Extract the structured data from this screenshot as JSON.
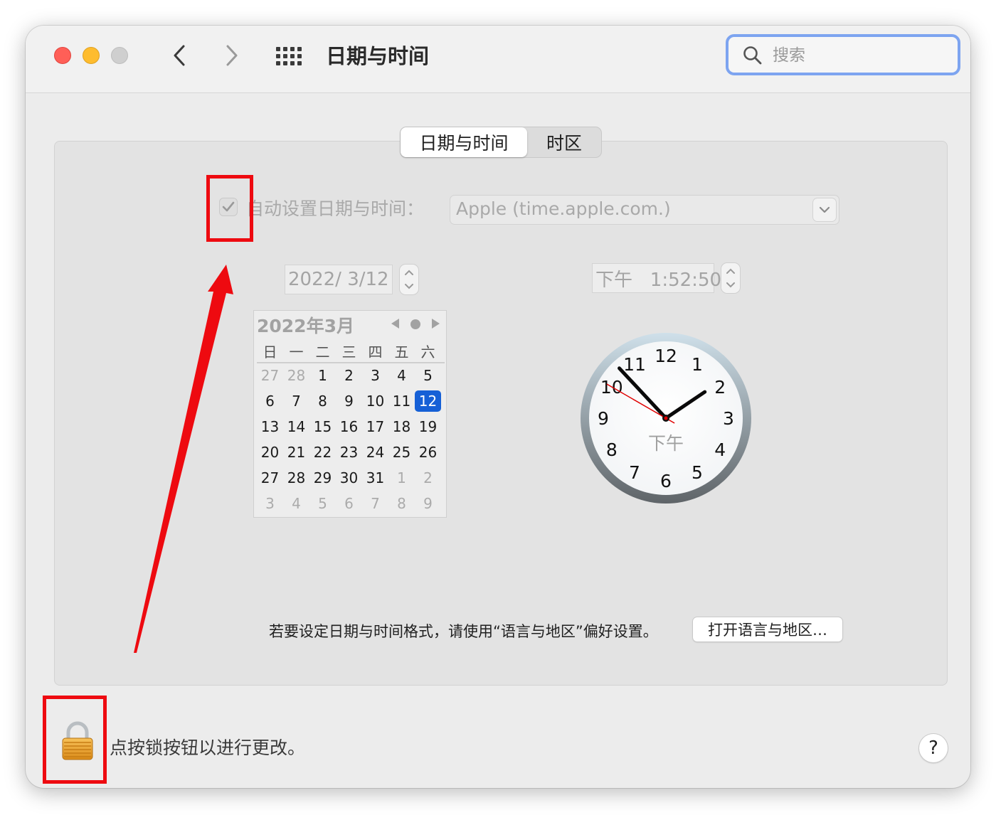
{
  "window": {
    "title": "日期与时间",
    "search_placeholder": "搜索"
  },
  "tabs": [
    {
      "label": "日期与时间",
      "active": true
    },
    {
      "label": "时区",
      "active": false
    }
  ],
  "auto_set": {
    "label": "自动设置日期与时间：",
    "checked": true,
    "server": "Apple (time.apple.com.)"
  },
  "date_field": "2022/  3/12",
  "time_field": "下午   1:52:50",
  "calendar": {
    "title": "2022年3月",
    "weekdays": [
      "日",
      "一",
      "二",
      "三",
      "四",
      "五",
      "六"
    ],
    "weeks": [
      [
        "27",
        "28",
        "1",
        "2",
        "3",
        "4",
        "5"
      ],
      [
        "6",
        "7",
        "8",
        "9",
        "10",
        "11",
        "12"
      ],
      [
        "13",
        "14",
        "15",
        "16",
        "17",
        "18",
        "19"
      ],
      [
        "20",
        "21",
        "22",
        "23",
        "24",
        "25",
        "26"
      ],
      [
        "27",
        "28",
        "29",
        "30",
        "31",
        "1",
        "2"
      ],
      [
        "3",
        "4",
        "5",
        "6",
        "7",
        "8",
        "9"
      ]
    ],
    "selected": "12"
  },
  "clock": {
    "numbers": [
      "12",
      "1",
      "2",
      "3",
      "4",
      "5",
      "6",
      "7",
      "8",
      "9",
      "10",
      "11"
    ],
    "ampm": "下午",
    "hour": 1,
    "minute": 52,
    "second": 50
  },
  "format_hint": "若要设定日期与时间格式，请使用“语言与地区”偏好设置。",
  "lang_button": "打开语言与地区…",
  "lock_label": "点按锁按钮以进行更改。",
  "help_label": "?",
  "colors": {
    "annotation": "#ee0a10",
    "selected_day": "#1660d6",
    "search_focus": "#7da4f0"
  }
}
